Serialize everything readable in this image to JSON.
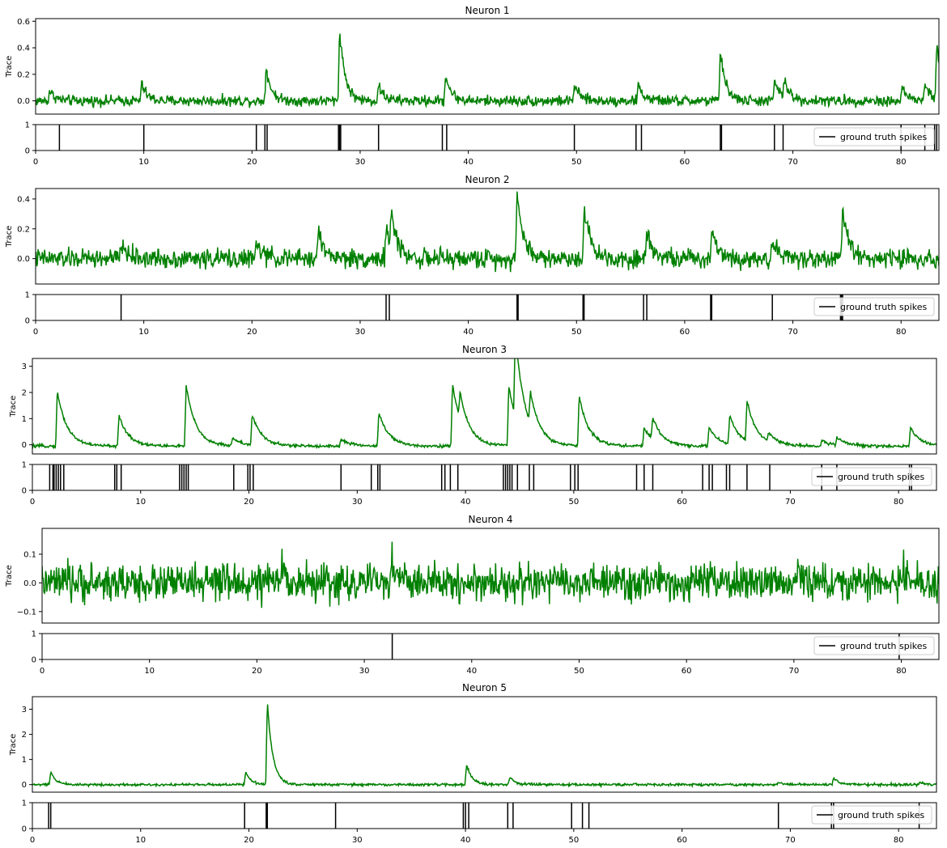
{
  "colors": {
    "trace": "#008000",
    "spike": "#000000",
    "axes": "#000000",
    "background": "#ffffff"
  },
  "chart_data": [
    {
      "type": "line",
      "title": "Neuron 1",
      "ylabel": "Trace",
      "xlim": [
        0,
        83.5
      ],
      "ylim": [
        -0.1,
        0.62
      ],
      "yticks": [
        0.0,
        0.2,
        0.4,
        0.6
      ],
      "ytick_labels": [
        "0.0",
        "0.2",
        "0.4",
        "0.6"
      ],
      "series": [
        {
          "values": []
        }
      ],
      "trace": {
        "baseline": 0.0,
        "noise": 0.025,
        "decay": 0.5,
        "peaks": [
          [
            1.3,
            0.08
          ],
          [
            9.8,
            0.13
          ],
          [
            21.3,
            0.25
          ],
          [
            28.1,
            0.55
          ],
          [
            31.7,
            0.12
          ],
          [
            37.9,
            0.2
          ],
          [
            49.8,
            0.12
          ],
          [
            55.7,
            0.12
          ],
          [
            63.3,
            0.38
          ],
          [
            68.3,
            0.16
          ],
          [
            69.2,
            0.14
          ],
          [
            80.1,
            0.1
          ],
          [
            82.2,
            0.13
          ],
          [
            83.3,
            0.42
          ]
        ]
      },
      "spikes_plot": {
        "ylim": [
          0,
          1
        ],
        "yticks": [
          0,
          1
        ],
        "ytick_labels": [
          "0",
          "1"
        ],
        "xticks": [
          0,
          10,
          20,
          30,
          40,
          50,
          60,
          70,
          80
        ],
        "xtick_labels": [
          "0",
          "10",
          "20",
          "30",
          "40",
          "50",
          "60",
          "70",
          "80"
        ],
        "legend": "ground truth spikes",
        "legend_position": "right",
        "spikes": [
          2.2,
          10.0,
          20.4,
          21.2,
          21.4,
          28.0,
          28.1,
          28.2,
          31.7,
          37.6,
          38.0,
          49.8,
          55.5,
          56.0,
          63.3,
          63.4,
          68.3,
          69.1,
          80.0,
          82.2,
          83.1,
          83.3
        ]
      }
    },
    {
      "type": "line",
      "title": "Neuron 2",
      "ylabel": "Trace",
      "xlim": [
        0,
        83.5
      ],
      "ylim": [
        -0.17,
        0.47
      ],
      "yticks": [
        0.0,
        0.2,
        0.4
      ],
      "ytick_labels": [
        "0.0",
        "0.2",
        "0.4"
      ],
      "series": [
        {
          "values": []
        }
      ],
      "trace": {
        "baseline": 0.0,
        "noise": 0.04,
        "decay": 0.6,
        "peaks": [
          [
            7.9,
            0.1
          ],
          [
            20.4,
            0.1
          ],
          [
            26.1,
            0.18
          ],
          [
            32.4,
            0.22
          ],
          [
            32.9,
            0.2
          ],
          [
            44.5,
            0.43
          ],
          [
            50.7,
            0.35
          ],
          [
            56.5,
            0.2
          ],
          [
            62.5,
            0.2
          ],
          [
            68.1,
            0.12
          ],
          [
            74.6,
            0.32
          ]
        ]
      },
      "spikes_plot": {
        "ylim": [
          0,
          1
        ],
        "yticks": [
          0,
          1
        ],
        "ytick_labels": [
          "0",
          "1"
        ],
        "xticks": [
          0,
          10,
          20,
          30,
          40,
          50,
          60,
          70,
          80
        ],
        "xtick_labels": [
          "0",
          "10",
          "20",
          "30",
          "40",
          "50",
          "60",
          "70",
          "80"
        ],
        "legend": "ground truth spikes",
        "legend_position": "right",
        "spikes": [
          7.9,
          32.4,
          32.7,
          44.5,
          44.6,
          50.6,
          50.7,
          56.2,
          56.5,
          62.4,
          62.5,
          68.1,
          74.4,
          74.5,
          74.6
        ]
      }
    },
    {
      "type": "line",
      "title": "Neuron 3",
      "ylabel": "Trace",
      "xlim": [
        0,
        83.5
      ],
      "ylim": [
        -0.35,
        3.3
      ],
      "yticks": [
        0,
        1,
        2,
        3
      ],
      "ytick_labels": [
        "0",
        "1",
        "2",
        "3"
      ],
      "series": [
        {
          "values": []
        }
      ],
      "trace": {
        "baseline": -0.05,
        "noise": 0.035,
        "decay": 0.9,
        "peaks": [
          [
            2.3,
            2.1
          ],
          [
            8.0,
            1.15
          ],
          [
            14.2,
            2.3
          ],
          [
            18.5,
            0.3
          ],
          [
            20.3,
            1.15
          ],
          [
            28.5,
            0.25
          ],
          [
            32.0,
            1.3
          ],
          [
            38.8,
            2.35
          ],
          [
            39.5,
            1.0
          ],
          [
            44.6,
            3.1
          ],
          [
            44.0,
            2.3
          ],
          [
            46.0,
            1.2
          ],
          [
            50.5,
            1.9
          ],
          [
            56.5,
            0.7
          ],
          [
            57.3,
            0.8
          ],
          [
            62.5,
            0.7
          ],
          [
            64.4,
            1.1
          ],
          [
            66.0,
            1.55
          ],
          [
            68.0,
            0.35
          ],
          [
            72.9,
            0.2
          ],
          [
            74.3,
            0.3
          ],
          [
            81.1,
            0.7
          ]
        ]
      },
      "spikes_plot": {
        "ylim": [
          0,
          1
        ],
        "yticks": [
          0,
          1
        ],
        "ytick_labels": [
          "0",
          "1"
        ],
        "xticks": [
          0,
          10,
          20,
          30,
          40,
          50,
          60,
          70,
          80
        ],
        "xtick_labels": [
          "0",
          "10",
          "20",
          "30",
          "40",
          "50",
          "60",
          "70",
          "80"
        ],
        "legend": "ground truth spikes",
        "legend_position": "right",
        "spikes": [
          1.6,
          1.9,
          2.0,
          2.2,
          2.4,
          2.6,
          2.9,
          7.6,
          7.8,
          8.2,
          13.6,
          13.8,
          14.0,
          14.2,
          14.4,
          18.6,
          19.9,
          20.1,
          20.4,
          28.5,
          31.3,
          31.9,
          32.1,
          37.8,
          38.1,
          38.6,
          39.3,
          43.5,
          43.7,
          43.9,
          44.1,
          44.3,
          44.8,
          45.9,
          46.3,
          49.7,
          50.1,
          50.4,
          55.8,
          56.5,
          57.3,
          61.9,
          62.5,
          62.8,
          64.1,
          64.4,
          66.0,
          68.1,
          72.9,
          74.3,
          81.0,
          81.2
        ]
      }
    },
    {
      "type": "line",
      "title": "Neuron 4",
      "ylabel": "Trace",
      "xlim": [
        0,
        83.5
      ],
      "ylim": [
        -0.14,
        0.19
      ],
      "yticks": [
        -0.1,
        0.0,
        0.1
      ],
      "ytick_labels": [
        "−0.1",
        "0.0",
        "0.1"
      ],
      "series": [
        {
          "values": []
        }
      ],
      "trace": {
        "baseline": 0.0,
        "noise": 0.04,
        "decay": 0.5,
        "peaks": [
          [
            22.3,
            0.06
          ],
          [
            32.6,
            0.08
          ],
          [
            70.2,
            0.06
          ],
          [
            80.0,
            0.05
          ]
        ]
      },
      "spikes_plot": {
        "ylim": [
          0,
          1
        ],
        "yticks": [
          0,
          1
        ],
        "ytick_labels": [
          "0",
          "1"
        ],
        "xticks": [
          0,
          10,
          20,
          30,
          40,
          50,
          60,
          70,
          80
        ],
        "xtick_labels": [
          "0",
          "10",
          "20",
          "30",
          "40",
          "50",
          "60",
          "70",
          "80"
        ],
        "legend": "ground truth spikes",
        "legend_position": "right",
        "spikes": [
          32.6,
          79.8
        ]
      }
    },
    {
      "type": "line",
      "title": "Neuron 5",
      "ylabel": "Trace",
      "xlim": [
        0,
        83.5
      ],
      "ylim": [
        -0.3,
        3.5
      ],
      "yticks": [
        0,
        1,
        2,
        3
      ],
      "ytick_labels": [
        "0",
        "1",
        "2",
        "3"
      ],
      "series": [
        {
          "values": []
        }
      ],
      "trace": {
        "baseline": 0.0,
        "noise": 0.03,
        "decay": 0.5,
        "peaks": [
          [
            1.7,
            0.5
          ],
          [
            19.7,
            0.5
          ],
          [
            21.7,
            3.3
          ],
          [
            40.1,
            0.8
          ],
          [
            44.1,
            0.3
          ],
          [
            68.9,
            0.1
          ],
          [
            74.0,
            0.3
          ],
          [
            82.0,
            0.1
          ]
        ]
      },
      "spikes_plot": {
        "ylim": [
          0,
          1
        ],
        "yticks": [
          0,
          1
        ],
        "ytick_labels": [
          "0",
          "1"
        ],
        "xticks": [
          0,
          10,
          20,
          30,
          40,
          50,
          60,
          70,
          80
        ],
        "xtick_labels": [
          "0",
          "10",
          "20",
          "30",
          "40",
          "50",
          "60",
          "70",
          "80"
        ],
        "legend": "ground truth spikes",
        "legend_position": "right",
        "spikes": [
          1.5,
          1.7,
          19.6,
          21.6,
          21.7,
          28.0,
          39.8,
          40.0,
          40.3,
          43.9,
          44.4,
          49.8,
          50.8,
          51.4,
          68.9,
          73.8,
          74.0,
          81.9
        ]
      }
    }
  ]
}
